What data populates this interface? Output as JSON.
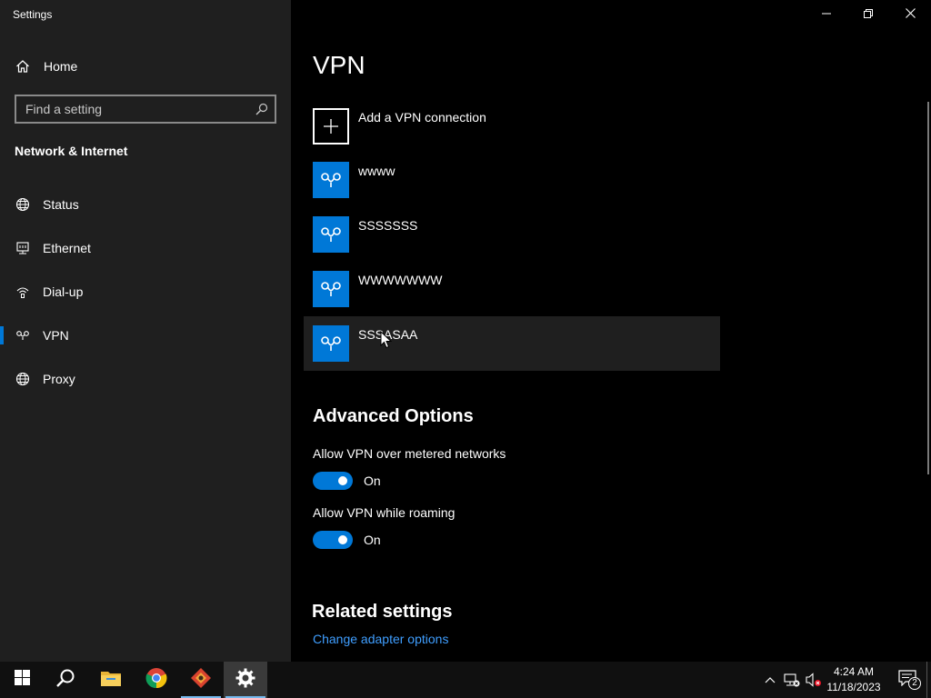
{
  "window": {
    "title": "Settings",
    "controls": [
      "minimize-icon",
      "restore-icon",
      "close-icon"
    ]
  },
  "sidebar": {
    "home_label": "Home",
    "search": {
      "placeholder": "Find a setting",
      "value": ""
    },
    "section_heading": "Network & Internet",
    "items": [
      {
        "label": "Status",
        "icon": "globe-icon",
        "selected": false
      },
      {
        "label": "Ethernet",
        "icon": "ethernet-icon",
        "selected": false
      },
      {
        "label": "Dial-up",
        "icon": "dialup-icon",
        "selected": false
      },
      {
        "label": "VPN",
        "icon": "vpn-icon",
        "selected": true
      },
      {
        "label": "Proxy",
        "icon": "globe-icon",
        "selected": false
      }
    ]
  },
  "main": {
    "title": "VPN",
    "add_connection_label": "Add a VPN connection",
    "connections": [
      {
        "name": "wwww"
      },
      {
        "name": "SSSSSSS"
      },
      {
        "name": "WWWWWWW"
      },
      {
        "name": "SSSASAA"
      }
    ],
    "advanced": {
      "heading": "Advanced Options",
      "options": [
        {
          "label": "Allow VPN over metered networks",
          "state": "On",
          "enabled": true
        },
        {
          "label": "Allow VPN while roaming",
          "state": "On",
          "enabled": true
        }
      ]
    },
    "related": {
      "heading": "Related settings",
      "link": "Change adapter options"
    }
  },
  "taskbar": {
    "apps": [
      "windows-start-icon",
      "search-icon",
      "file-explorer-icon",
      "chrome-icon",
      "app-icon",
      "settings-gear-icon"
    ],
    "active_app": "settings-gear-icon",
    "tray": [
      "chevron-up-icon",
      "network-disconnected-icon",
      "volume-muted-icon"
    ],
    "time": "4:24 AM",
    "date": "11/18/2023",
    "notification_count": "2"
  },
  "colors": {
    "accent": "#0078d7",
    "sidebar_bg": "#1f1f1f",
    "main_bg": "#000000",
    "link": "#3f9eff"
  }
}
